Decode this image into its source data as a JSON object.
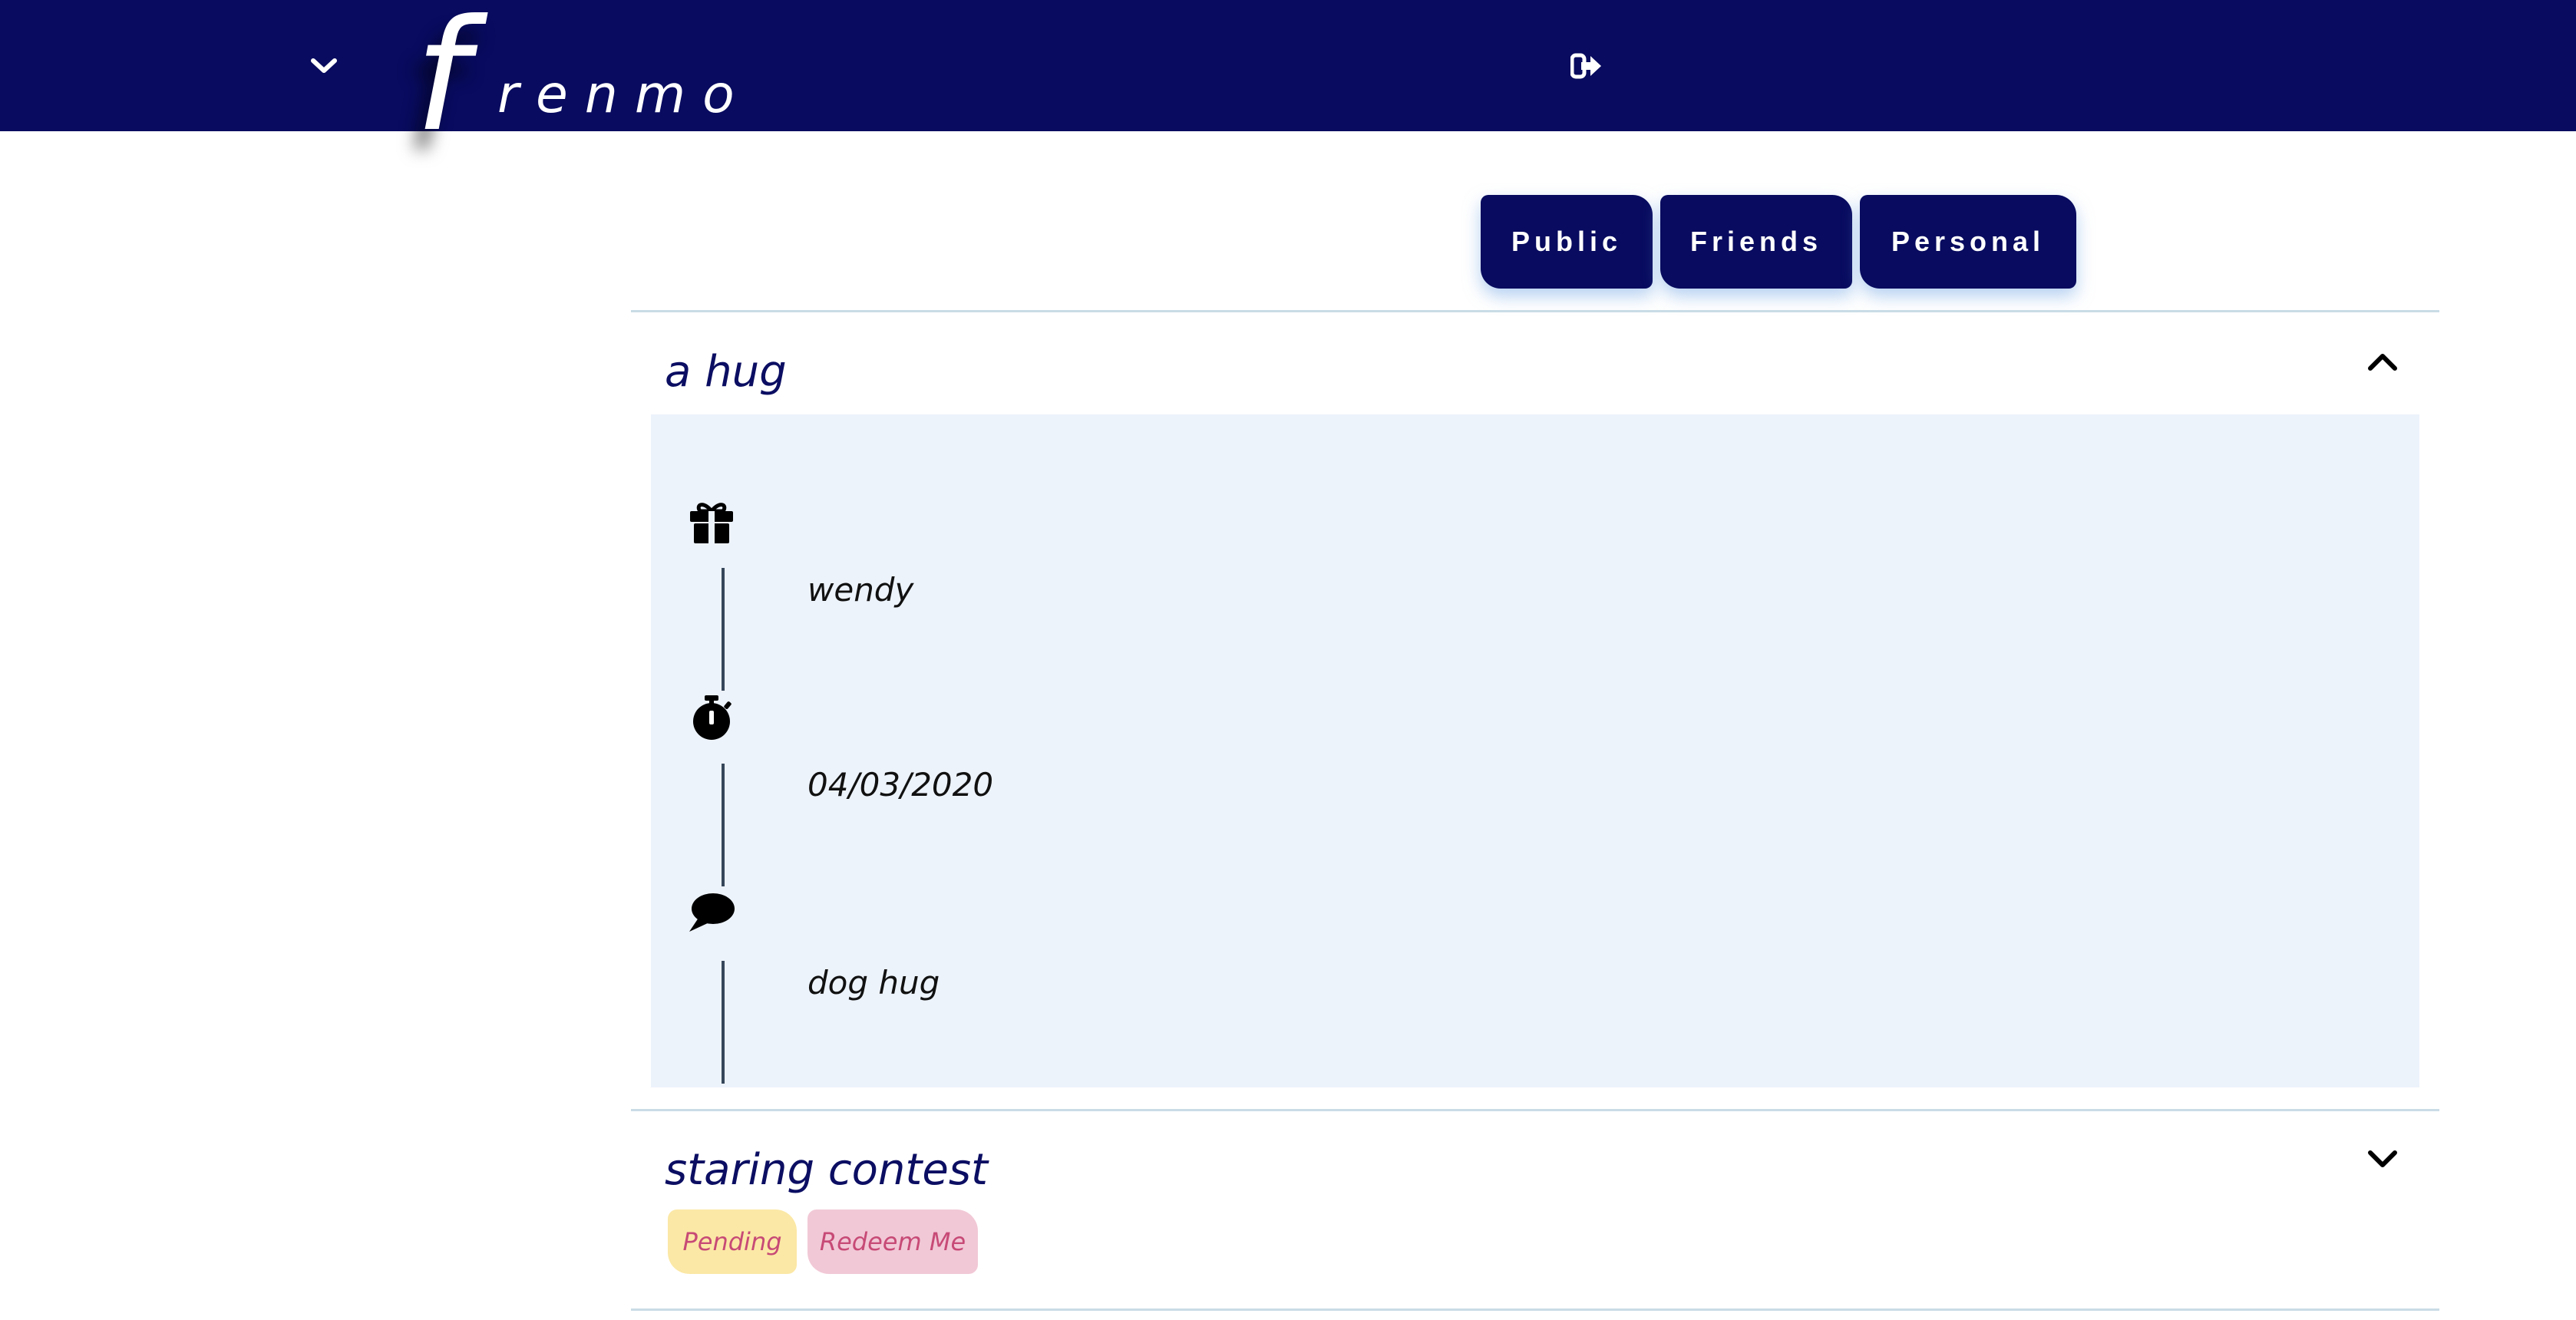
{
  "header": {
    "logo_initial": "f",
    "logo_rest": "renmo",
    "background_color": "#080b5f",
    "menu_icon": "chevron-down-icon",
    "logout_icon": "sign-out-icon"
  },
  "tabs": [
    {
      "label": "Public"
    },
    {
      "label": "Friends"
    },
    {
      "label": "Personal"
    }
  ],
  "items": [
    {
      "title": "a hug",
      "expanded": true,
      "toggle_icon": "chevron-up-icon",
      "details": [
        {
          "icon": "gift-icon",
          "value": "wendy"
        },
        {
          "icon": "stopwatch-icon",
          "value": "04/03/2020"
        },
        {
          "icon": "comment-icon",
          "value": "dog hug"
        }
      ]
    },
    {
      "title": "staring contest",
      "expanded": false,
      "toggle_icon": "chevron-down-icon",
      "badges": [
        {
          "label": "Pending",
          "color": "#fbe8a6"
        },
        {
          "label": "Redeem Me",
          "color": "#f1c8d6"
        }
      ]
    }
  ],
  "colors": {
    "primary": "#080b5f",
    "panel": "#edf3fb",
    "divider": "#c9dce6",
    "badge_text": "#c74a76"
  }
}
